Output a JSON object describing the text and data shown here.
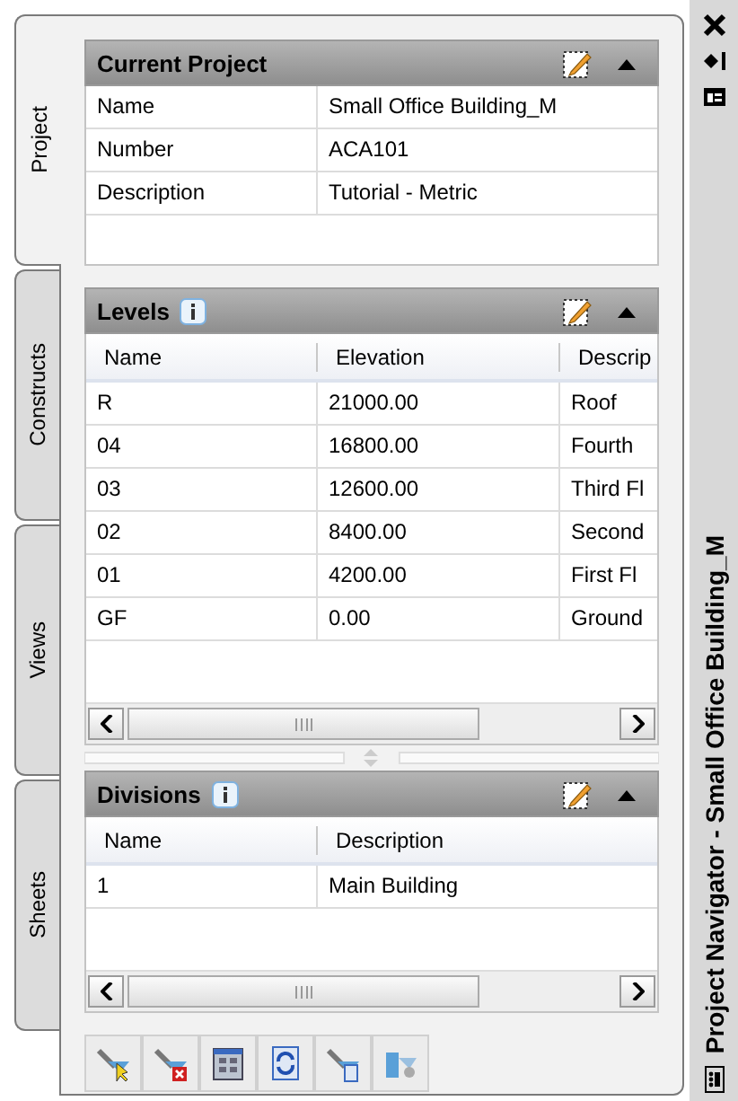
{
  "tabs": [
    {
      "label": "Project",
      "selected": true
    },
    {
      "label": "Constructs",
      "selected": false
    },
    {
      "label": "Views",
      "selected": false
    },
    {
      "label": "Sheets",
      "selected": false
    }
  ],
  "sections": [
    {
      "kind": "properties",
      "title": "Current Project",
      "info": false,
      "rows": [
        [
          "Name",
          "Small Office Building_M"
        ],
        [
          "Number",
          "ACA101"
        ],
        [
          "Description",
          "Tutorial - Metric"
        ]
      ]
    },
    {
      "kind": "table",
      "title": "Levels",
      "info": true,
      "columns": [
        "Name",
        "Elevation",
        "Descrip"
      ],
      "rows": [
        [
          "R",
          "21000.00",
          "Roof"
        ],
        [
          "04",
          "16800.00",
          "Fourth"
        ],
        [
          "03",
          "12600.00",
          "Third Fl"
        ],
        [
          "02",
          "8400.00",
          "Second"
        ],
        [
          "01",
          "4200.00",
          "First Fl"
        ],
        [
          "GF",
          "0.00",
          "Ground"
        ]
      ]
    },
    {
      "kind": "table",
      "title": "Divisions",
      "info": true,
      "columns": [
        "Name",
        "Description"
      ],
      "rows": [
        [
          "1",
          "Main Building"
        ]
      ]
    }
  ],
  "title_bar": {
    "title": "Project Navigator - Small Office Building_M"
  }
}
